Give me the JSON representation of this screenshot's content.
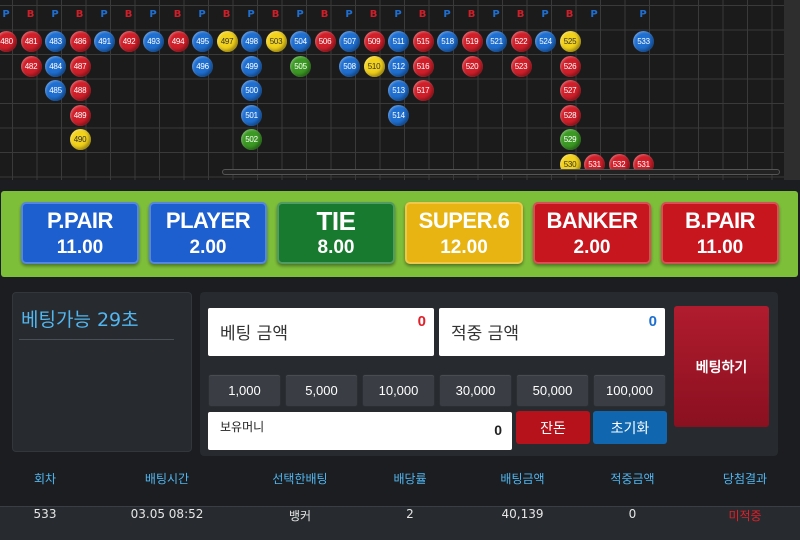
{
  "roadmap": {
    "header": [
      "P",
      "B",
      "P",
      "B",
      "P",
      "B",
      "P",
      "B",
      "P",
      "B",
      "P",
      "B",
      "P",
      "B",
      "P",
      "B",
      "P",
      "B",
      "P",
      "B",
      "P",
      "B",
      "P",
      "B",
      "P",
      "",
      "P"
    ],
    "colors": {
      "P": "#1f6fd1",
      "B": "#d11f2a",
      "G": "#3c9a24",
      "Y": "#f3d21b"
    },
    "columns": [
      [
        [
          "480",
          "B"
        ]
      ],
      [
        [
          "481",
          "B"
        ],
        [
          "482",
          "B"
        ]
      ],
      [
        [
          "483",
          "P"
        ],
        [
          "484",
          "P"
        ],
        [
          "485",
          "P"
        ]
      ],
      [
        [
          "486",
          "B"
        ],
        [
          "487",
          "B"
        ],
        [
          "488",
          "B"
        ],
        [
          "489",
          "B"
        ],
        [
          "490",
          "Y"
        ]
      ],
      [
        [
          "491",
          "P"
        ]
      ],
      [
        [
          "492",
          "B"
        ]
      ],
      [
        [
          "493",
          "P"
        ]
      ],
      [
        [
          "494",
          "B"
        ]
      ],
      [
        [
          "495",
          "P"
        ],
        [
          "496",
          "P"
        ]
      ],
      [
        [
          "497",
          "Y"
        ]
      ],
      [
        [
          "498",
          "P"
        ],
        [
          "499",
          "P"
        ],
        [
          "500",
          "P"
        ],
        [
          "501",
          "P"
        ],
        [
          "502",
          "G"
        ]
      ],
      [
        [
          "503",
          "Y"
        ]
      ],
      [
        [
          "504",
          "P"
        ],
        [
          "505",
          "G"
        ]
      ],
      [
        [
          "506",
          "B"
        ]
      ],
      [
        [
          "507",
          "P"
        ],
        [
          "508",
          "P"
        ]
      ],
      [
        [
          "509",
          "B"
        ],
        [
          "510",
          "Y"
        ]
      ],
      [
        [
          "511",
          "P"
        ],
        [
          "512",
          "P"
        ],
        [
          "513",
          "P"
        ],
        [
          "514",
          "P"
        ]
      ],
      [
        [
          "515",
          "B"
        ],
        [
          "516",
          "B"
        ],
        [
          "517",
          "B"
        ]
      ],
      [
        [
          "518",
          "P"
        ]
      ],
      [
        [
          "519",
          "B"
        ],
        [
          "520",
          "B"
        ]
      ],
      [
        [
          "521",
          "P"
        ]
      ],
      [
        [
          "522",
          "B"
        ],
        [
          "523",
          "B"
        ]
      ],
      [
        [
          "524",
          "P"
        ]
      ],
      [
        [
          "525",
          "Y"
        ],
        [
          "526",
          "B"
        ],
        [
          "527",
          "B"
        ],
        [
          "528",
          "B"
        ],
        [
          "529",
          "G"
        ],
        [
          "530",
          "Y"
        ]
      ],
      [
        [
          "531",
          "B"
        ]
      ],
      [
        [
          "532",
          "B"
        ]
      ],
      [
        [
          "533",
          "P"
        ],
        [
          "531",
          "B"
        ]
      ]
    ]
  },
  "bets": [
    {
      "name": "P.PAIR",
      "odds": "11.00",
      "color": "#1e5fd0"
    },
    {
      "name": "PLAYER",
      "odds": "2.00",
      "color": "#1e5fd0"
    },
    {
      "name": "TIE",
      "odds": "8.00",
      "color": "#187a2f"
    },
    {
      "name": "SUPER.6",
      "odds": "12.00",
      "color": "#e8b412"
    },
    {
      "name": "BANKER",
      "odds": "2.00",
      "color": "#c8161e"
    },
    {
      "name": "B.PAIR",
      "odds": "11.00",
      "color": "#c8161e"
    }
  ],
  "timer": {
    "text": "베팅가능 29초"
  },
  "form": {
    "bet_amount_label": "베팅 금액",
    "bet_amount_value": "0",
    "win_amount_label": "적중 금액",
    "win_amount_value": "0",
    "chips": [
      "1,000",
      "5,000",
      "10,000",
      "30,000",
      "50,000",
      "100,000"
    ],
    "holding_label": "보유머니",
    "holding_value": "0",
    "allin_label": "잔돈",
    "reset_label": "초기화",
    "place_bet_label": "베팅하기"
  },
  "history": {
    "headers": [
      "회차",
      "배팅시간",
      "선택한배팅",
      "배당률",
      "배팅금액",
      "적중금액",
      "당첨결과"
    ],
    "rows": [
      [
        "533",
        "03.05 08:52",
        "뱅커",
        "2",
        "40,139",
        "0",
        "미적중"
      ]
    ]
  }
}
